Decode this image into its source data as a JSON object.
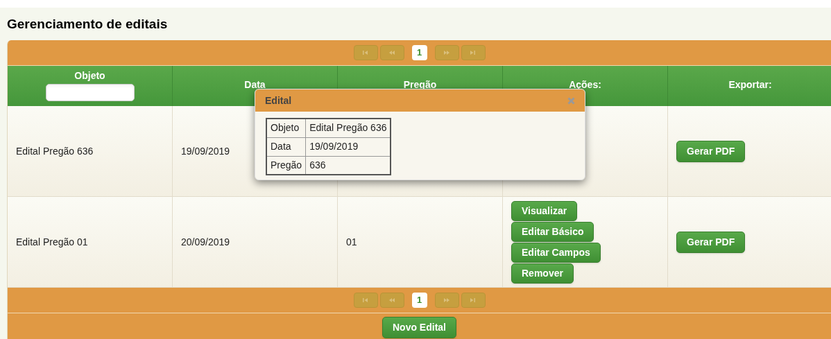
{
  "page": {
    "title": "Gerenciamento de editais"
  },
  "pager_top": [
    {
      "kind": "first",
      "disabled": true
    },
    {
      "kind": "prev",
      "disabled": true
    },
    {
      "kind": "page",
      "label": "1",
      "selected": true
    },
    {
      "kind": "next",
      "disabled": true
    },
    {
      "kind": "last",
      "disabled": true
    }
  ],
  "table": {
    "columns": [
      {
        "label": "Objeto",
        "filter": true
      },
      {
        "label": "Data",
        "filter": false
      },
      {
        "label": "Pregão",
        "filter": false
      },
      {
        "label": "Ações:",
        "filter": false
      },
      {
        "label": "Exportar:",
        "filter": false
      }
    ],
    "rows": [
      {
        "objeto": "Edital Pregão 636",
        "data": "19/09/2019",
        "pregao": "",
        "actions": [],
        "export": "Gerar PDF"
      },
      {
        "objeto": "Edital Pregão 01",
        "data": "20/09/2019",
        "pregao": "01",
        "actions": [
          "Visualizar",
          "Editar Básico",
          "Editar Campos",
          "Remover"
        ],
        "export": "Gerar PDF"
      }
    ]
  },
  "pager_bottom": [
    {
      "kind": "first",
      "disabled": true
    },
    {
      "kind": "prev",
      "disabled": true
    },
    {
      "kind": "page",
      "label": "1",
      "selected": true
    },
    {
      "kind": "next",
      "disabled": true
    },
    {
      "kind": "last",
      "disabled": true
    }
  ],
  "footer": {
    "button": "Novo Edital"
  },
  "dialog": {
    "title": "Edital",
    "fields": [
      {
        "label": "Objeto",
        "value": "Edital Pregão 636"
      },
      {
        "label": "Data",
        "value": "19/09/2019"
      },
      {
        "label": "Pregão",
        "value": "636"
      }
    ]
  }
}
